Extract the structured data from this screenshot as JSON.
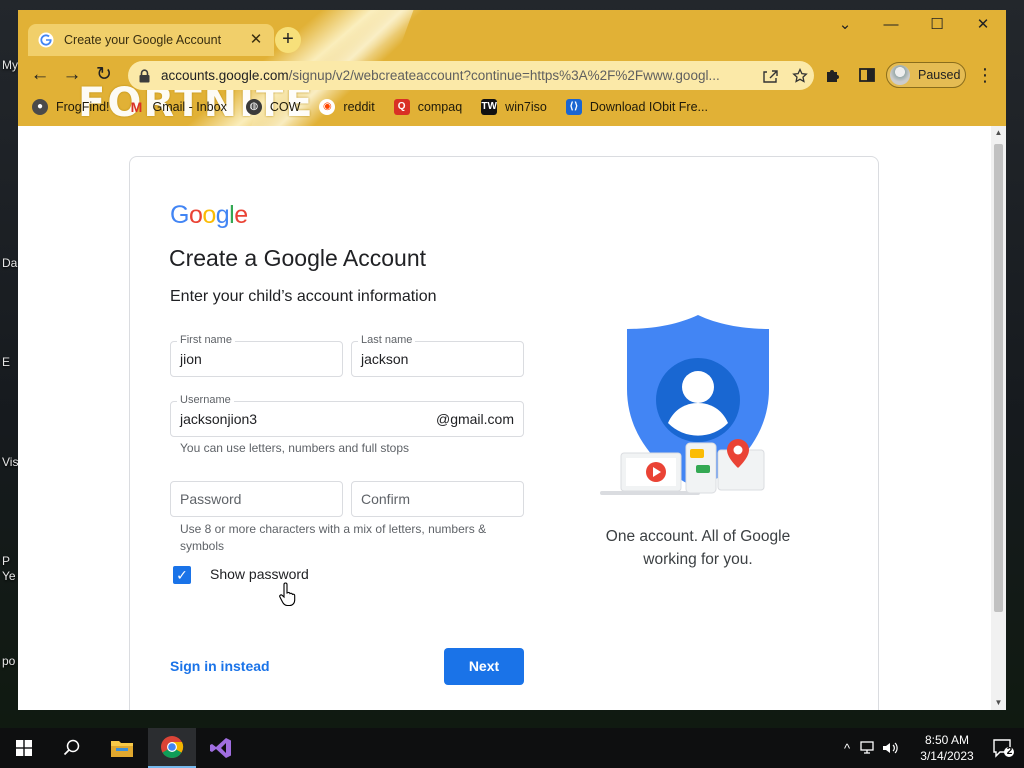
{
  "desktop": {
    "labels": [
      "My",
      "Da",
      "E",
      "Vis",
      "P",
      "Ye",
      "po"
    ]
  },
  "browser": {
    "tab": {
      "title": "Create your Google Account",
      "close_glyph": "✕"
    },
    "new_tab_glyph": "+",
    "theme_text": "FORTNITE",
    "window_controls": {
      "collapse": "⌄",
      "minimize": "—",
      "maximize": "☐",
      "close": "✕"
    },
    "nav": {
      "back": "←",
      "forward": "→",
      "reload": "↻"
    },
    "address": {
      "host": "accounts.google.com",
      "path": "/signup/v2/webcreateaccount?continue=https%3A%2F%2Fwww.googl..."
    },
    "profile": {
      "label": "Paused"
    },
    "bookmarks": [
      {
        "label": "FrogFind!",
        "icon": "frog-icon",
        "color": "#4a4a4a"
      },
      {
        "label": "Gmail - Inbox",
        "icon": "gmail-icon",
        "color": "#d93025"
      },
      {
        "label": "COW",
        "icon": "globe-icon",
        "color": "#3a3a3a"
      },
      {
        "label": "reddit",
        "icon": "reddit-icon",
        "color": "#ff4500"
      },
      {
        "label": "compaq",
        "icon": "search-icon",
        "color": "#d93025"
      },
      {
        "label": "win7iso",
        "icon": "tw-icon",
        "color": "#111111"
      },
      {
        "label": "Download IObit Fre...",
        "icon": "iobit-icon",
        "color": "#1a66d2"
      }
    ]
  },
  "page": {
    "logo": "Google",
    "title": "Create a Google Account",
    "subtitle": "Enter your child’s account information",
    "first_name": {
      "label": "First name",
      "value": "jion"
    },
    "last_name": {
      "label": "Last name",
      "value": "jackson"
    },
    "username": {
      "label": "Username",
      "value": "jacksonjion3",
      "suffix": "@gmail.com",
      "hint": "You can use letters, numbers and full stops"
    },
    "password": {
      "placeholder": "Password"
    },
    "confirm": {
      "placeholder": "Confirm"
    },
    "password_hint": "Use 8 or more characters with a mix of letters, numbers & symbols",
    "show_password": {
      "label": "Show password",
      "checked": true
    },
    "sign_in_instead": "Sign in instead",
    "next": "Next",
    "tagline": "One account. All of Google working for you."
  },
  "taskbar": {
    "time": "8:50 AM",
    "date": "3/14/2023",
    "notification_count": "2"
  },
  "colors": {
    "theme": "#e1b136",
    "primary": "#1a73e8",
    "google_blue": "#4285f4",
    "google_red": "#ea4335",
    "google_yellow": "#fbbc05",
    "google_green": "#34a853"
  }
}
